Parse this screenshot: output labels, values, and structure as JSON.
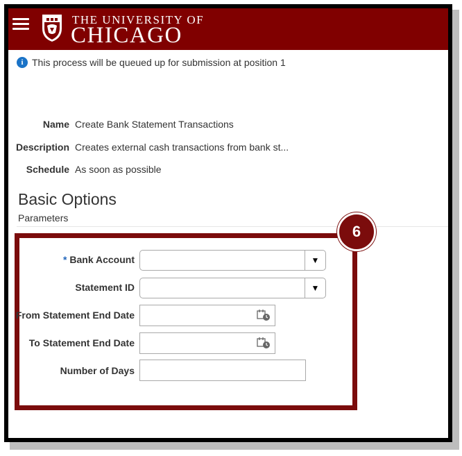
{
  "header": {
    "menu_icon": "hamburger-icon",
    "logo_top": "THE UNIVERSITY OF",
    "logo_main": "CHICAGO",
    "brand_color": "#800000"
  },
  "info_message": "This process will be queued up for submission at position 1",
  "details": [
    {
      "label": "Name",
      "value": "Create Bank Statement Transactions"
    },
    {
      "label": "Description",
      "value": "Creates external cash transactions from bank st..."
    },
    {
      "label": "Schedule",
      "value": "As soon as possible"
    }
  ],
  "section_title": "Basic Options",
  "parameters_label": "Parameters",
  "callout_number": "6",
  "fields": {
    "bank_account": {
      "label": "Bank Account",
      "required_marker": "*",
      "value": ""
    },
    "statement_id": {
      "label": "Statement ID",
      "value": ""
    },
    "from_date": {
      "label": "From Statement End Date",
      "value": ""
    },
    "to_date": {
      "label": "To Statement End Date",
      "value": ""
    },
    "num_days": {
      "label": "Number of Days",
      "value": ""
    }
  }
}
